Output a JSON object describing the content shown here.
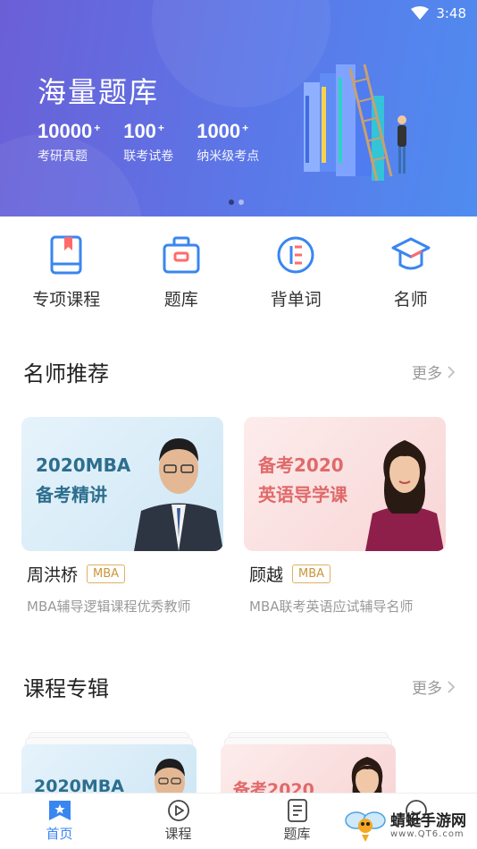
{
  "status_bar": {
    "time": "3:48"
  },
  "banner": {
    "title": "海量题库",
    "stats": [
      {
        "num": "10000",
        "plus": "+",
        "label": "考研真题"
      },
      {
        "num": "100",
        "plus": "+",
        "label": "联考试卷"
      },
      {
        "num": "1000",
        "plus": "+",
        "label": "纳米级考点"
      }
    ],
    "page_indicator": {
      "current": 1,
      "total": 2
    }
  },
  "quick_menu": [
    {
      "label": "专项课程",
      "icon": "book-icon"
    },
    {
      "label": "题库",
      "icon": "briefcase-icon"
    },
    {
      "label": "背单词",
      "icon": "letter-e-icon"
    },
    {
      "label": "名师",
      "icon": "graduation-cap-icon"
    }
  ],
  "teachers_section": {
    "title": "名师推荐",
    "more": "更多",
    "cards": [
      {
        "cover_line1": "2020MBA",
        "cover_line2": "备考精讲",
        "name": "周洪桥",
        "tag": "MBA",
        "desc": "MBA辅导逻辑课程优秀教师"
      },
      {
        "cover_line1": "备考2020",
        "cover_line2": "英语导学课",
        "name": "顾越",
        "tag": "MBA",
        "desc": "MBA联考英语应试辅导名师"
      }
    ]
  },
  "courses_section": {
    "title": "课程专辑",
    "more": "更多",
    "cards": [
      {
        "cover_line1": "2020MBA"
      },
      {
        "cover_line1": "备考2020"
      }
    ]
  },
  "tabbar": [
    {
      "label": "首页",
      "icon": "star-bookmark-icon",
      "active": true
    },
    {
      "label": "课程",
      "icon": "play-icon",
      "active": false
    },
    {
      "label": "题库",
      "icon": "document-icon",
      "active": false
    },
    {
      "label": "",
      "icon": "face-icon",
      "active": false
    }
  ],
  "watermark": {
    "text": "蜻蜓手游网",
    "url": "www.QT6.com"
  },
  "colors": {
    "accent": "#3a86f0",
    "banner_start": "#6b5fd6",
    "banner_end": "#4f8cf0",
    "badge": "#c8963a"
  }
}
